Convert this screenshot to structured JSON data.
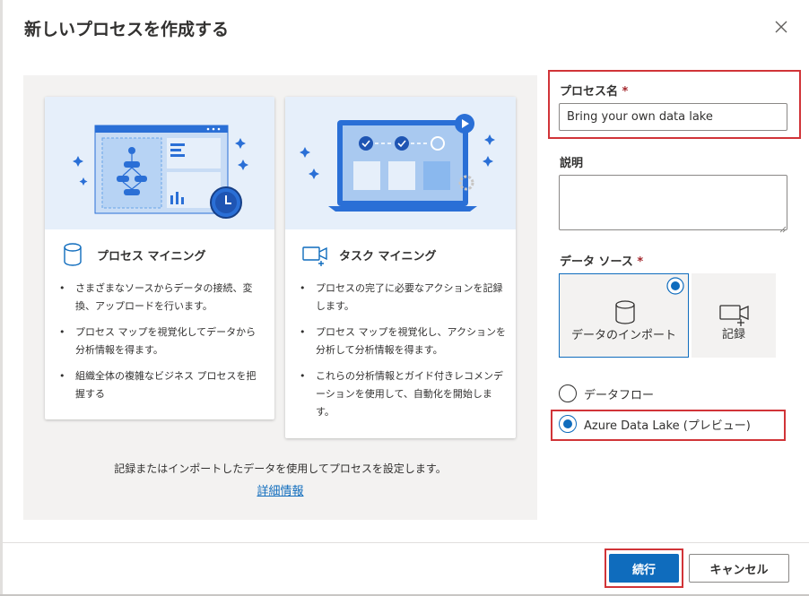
{
  "dialog": {
    "title": "新しいプロセスを作成する",
    "close_icon": "close-icon"
  },
  "cards": [
    {
      "title": "プロセス マイニング",
      "icon": "database-icon",
      "bullets": [
        "さまざまなソースからデータの接続、変換、アップロードを行います。",
        "プロセス マップを視覚化してデータから分析情報を得ます。",
        "組織全体の複雑なビジネス プロセスを把握する"
      ]
    },
    {
      "title": "タスク マイニング",
      "icon": "video-camera-icon",
      "bullets": [
        "プロセスの完了に必要なアクションを記録します。",
        "プロセス マップを視覚化し、アクションを分析して分析情報を得ます。",
        "これらの分析情報とガイド付きレコメンデーションを使用して、自動化を開始します。"
      ]
    }
  ],
  "panel": {
    "footnote": "記録またはインポートしたデータを使用してプロセスを設定します。",
    "link": "詳細情報"
  },
  "form": {
    "process_name_label": "プロセス名",
    "required_mark": "*",
    "process_name_value": "Bring your own data lake",
    "description_label": "説明",
    "description_value": "",
    "datasource_label": "データ ソース",
    "datasource_tiles": [
      {
        "label": "データのインポート",
        "icon": "database-icon",
        "selected": true
      },
      {
        "label": "記録",
        "icon": "video-camera-icon",
        "selected": false
      }
    ],
    "import_options": [
      {
        "label": "データフロー",
        "selected": false
      },
      {
        "label": "Azure Data Lake (プレビュー)",
        "selected": true
      }
    ]
  },
  "footer": {
    "continue_label": "続行",
    "cancel_label": "キャンセル"
  },
  "colors": {
    "accent": "#0f6cbd",
    "highlight": "#d13438",
    "panel_bg": "#f3f2f1",
    "illustration_bg": "#e6effa"
  }
}
